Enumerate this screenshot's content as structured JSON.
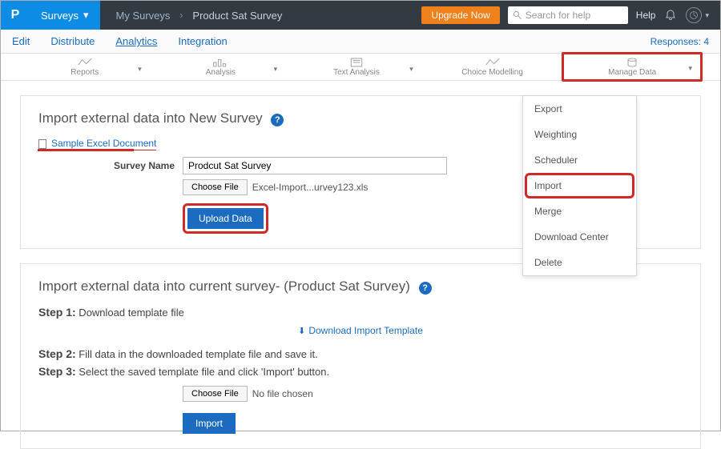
{
  "topbar": {
    "logo_label": "P",
    "surveys_label": "Surveys",
    "breadcrumb_my": "My Surveys",
    "breadcrumb_current": "Product Sat Survey",
    "upgrade_label": "Upgrade Now",
    "search_placeholder": "Search for help",
    "help_label": "Help"
  },
  "tabs": {
    "edit": "Edit",
    "distribute": "Distribute",
    "analytics": "Analytics",
    "integration": "Integration",
    "responses": "Responses: 4"
  },
  "toolbar": {
    "reports": "Reports",
    "analysis": "Analysis",
    "text_analysis": "Text Analysis",
    "choice_modelling": "Choice Modelling",
    "manage_data": "Manage Data"
  },
  "dropdown": {
    "export": "Export",
    "weighting": "Weighting",
    "scheduler": "Scheduler",
    "import": "Import",
    "merge": "Merge",
    "download_center": "Download Center",
    "delete": "Delete"
  },
  "panel1": {
    "title": "Import external data into New Survey",
    "sample_link": "Sample Excel Document",
    "survey_name_label": "Survey Name",
    "survey_name_value": "Prodcut Sat Survey",
    "choose_file": "Choose File",
    "chosen_file_text": "Excel-Import...urvey123.xls",
    "upload_btn": "Upload Data"
  },
  "panel2": {
    "title": "Import external data into current survey- (Product Sat Survey)",
    "step1_label": "Step 1:",
    "step1_text": " Download template file",
    "download_template": "Download Import Template",
    "step2_label": "Step 2:",
    "step2_text": " Fill data in the downloaded template file and save it.",
    "step3_label": "Step 3:",
    "step3_text": " Select the saved template file and click 'Import' button.",
    "choose_file": "Choose File",
    "no_file": "No file chosen",
    "import_btn": "Import"
  }
}
